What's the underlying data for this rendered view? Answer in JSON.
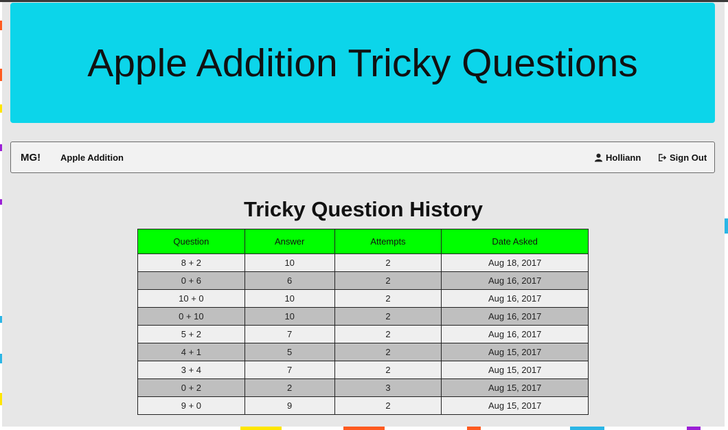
{
  "header": {
    "title": "Apple Addition Tricky Questions"
  },
  "navbar": {
    "brand": "MG!",
    "app_link": "Apple Addition",
    "user_name": "Holliann",
    "sign_out": "Sign Out"
  },
  "section_title": "Tricky Question History",
  "table": {
    "columns": [
      "Question",
      "Answer",
      "Attempts",
      "Date Asked"
    ],
    "rows": [
      [
        "8 + 2",
        "10",
        "2",
        "Aug 18, 2017"
      ],
      [
        "0 + 6",
        "6",
        "2",
        "Aug 16, 2017"
      ],
      [
        "10 + 0",
        "10",
        "2",
        "Aug 16, 2017"
      ],
      [
        "0 + 10",
        "10",
        "2",
        "Aug 16, 2017"
      ],
      [
        "5 + 2",
        "7",
        "2",
        "Aug 16, 2017"
      ],
      [
        "4 + 1",
        "5",
        "2",
        "Aug 15, 2017"
      ],
      [
        "3 + 4",
        "7",
        "2",
        "Aug 15, 2017"
      ],
      [
        "0 + 2",
        "2",
        "3",
        "Aug 15, 2017"
      ],
      [
        "9 + 0",
        "9",
        "2",
        "Aug 15, 2017"
      ]
    ]
  },
  "colors": {
    "jumbotron": "#0cd5ea",
    "table_header": "#00ff00",
    "row_light": "#efefef",
    "row_dark": "#bfbfbf"
  }
}
